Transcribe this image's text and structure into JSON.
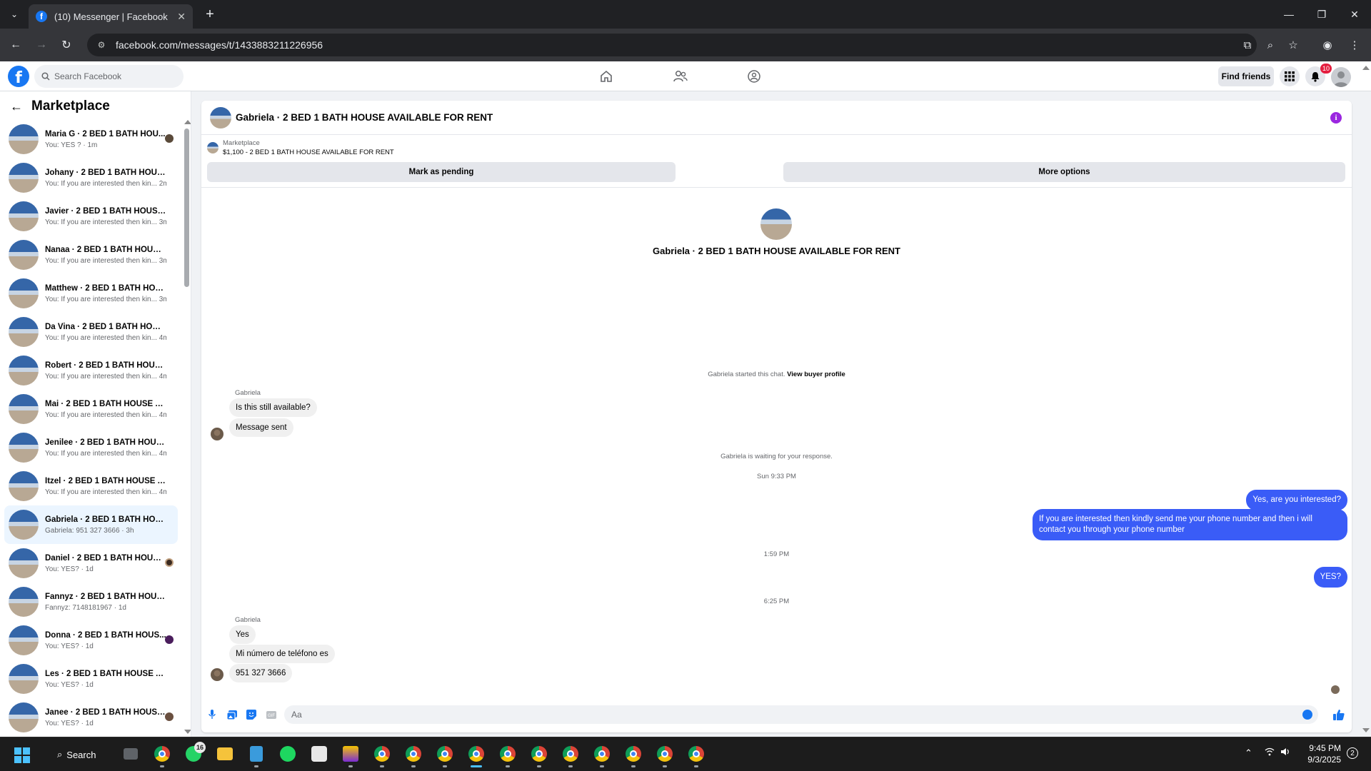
{
  "browser": {
    "tab_title": "(10) Messenger | Facebook",
    "url": "facebook.com/messages/t/1433883211226956"
  },
  "fb_nav": {
    "search_placeholder": "Search Facebook",
    "find_friends": "Find friends",
    "notification_count": "10"
  },
  "sidebar": {
    "title": "Marketplace",
    "conversations": [
      {
        "name": "Maria G · 2 BED 1 BATH HOU...",
        "preview": "You: YES ? · 1m"
      },
      {
        "name": "Johany · 2 BED 1 BATH HOUSE ...",
        "preview": "You: If you are interested then kin... 2m"
      },
      {
        "name": "Javier · 2 BED 1 BATH HOUSE A...",
        "preview": "You: If you are interested then kin... 3m"
      },
      {
        "name": "Nanaa · 2 BED 1 BATH HOUSE A...",
        "preview": "You: If you are interested then kin... 3m"
      },
      {
        "name": "Matthew · 2 BED 1 BATH HOUS...",
        "preview": "You: If you are interested then kin... 3m"
      },
      {
        "name": "Da Vina · 2 BED 1 BATH HOUSE ...",
        "preview": "You: If you are interested then kin... 4m"
      },
      {
        "name": "Robert · 2 BED 1 BATH HOUSE ...",
        "preview": "You: If you are interested then kin... 4m"
      },
      {
        "name": "Mai · 2 BED 1 BATH HOUSE AVA...",
        "preview": "You: If you are interested then kin... 4m"
      },
      {
        "name": "Jenilee · 2 BED 1 BATH HOUSE ...",
        "preview": "You: If you are interested then kin... 4m"
      },
      {
        "name": "Itzel · 2 BED 1 BATH HOUSE AV...",
        "preview": "You: If you are interested then kin... 4m"
      },
      {
        "name": "Gabriela · 2 BED 1 BATH HOUSE...",
        "preview": "Gabriela: 951 327 3666 · 3h"
      },
      {
        "name": "Daniel · 2 BED 1 BATH HOUSE...",
        "preview": "You: YES? · 1d"
      },
      {
        "name": "Fannyz · 2 BED 1 BATH HOUSE ...",
        "preview": "Fannyz: 7148181967 · 1d"
      },
      {
        "name": "Donna · 2 BED 1 BATH HOUS...",
        "preview": "You: YES? · 1d"
      },
      {
        "name": "Les · 2 BED 1 BATH HOUSE AVAI...",
        "preview": "You: YES? · 1d"
      },
      {
        "name": "Janee · 2 BED 1 BATH HOUSE ...",
        "preview": "You: YES? · 1d"
      }
    ]
  },
  "chat": {
    "header_title": "Gabriela · 2 BED 1 BATH HOUSE AVAILABLE FOR RENT",
    "listing_source": "Marketplace",
    "listing_price_title": "$1,100 - 2 BED 1 BATH HOUSE AVAILABLE FOR RENT",
    "mark_pending": "Mark as pending",
    "more_options": "More options",
    "intro_title": "Gabriela · 2 BED 1 BATH HOUSE AVAILABLE FOR RENT",
    "started_text": "Gabriela started this chat.",
    "view_profile": "View buyer profile",
    "sender_name": "Gabriela",
    "msg_in_1": "Is this still available?",
    "msg_in_2": "Message sent",
    "waiting_text": "Gabriela is waiting for your response.",
    "time_1": "Sun 9:33 PM",
    "msg_out_1": "Yes, are you interested?",
    "msg_out_2": "If you are interested then kindly send me your phone number and then i will contact you through your phone number",
    "time_2": "1:59 PM",
    "msg_out_3": "YES?",
    "time_3": "6:25 PM",
    "sender_name_2": "Gabriela",
    "msg_in_3": "Yes",
    "msg_in_4": "Mi número de teléfono es",
    "msg_in_5": "951 327 3666",
    "composer_placeholder": "Aa"
  },
  "taskbar": {
    "search_label": "Search",
    "whatsapp_badge": "16",
    "time": "9:45 PM",
    "date": "9/3/2025",
    "notification_count": "2"
  }
}
